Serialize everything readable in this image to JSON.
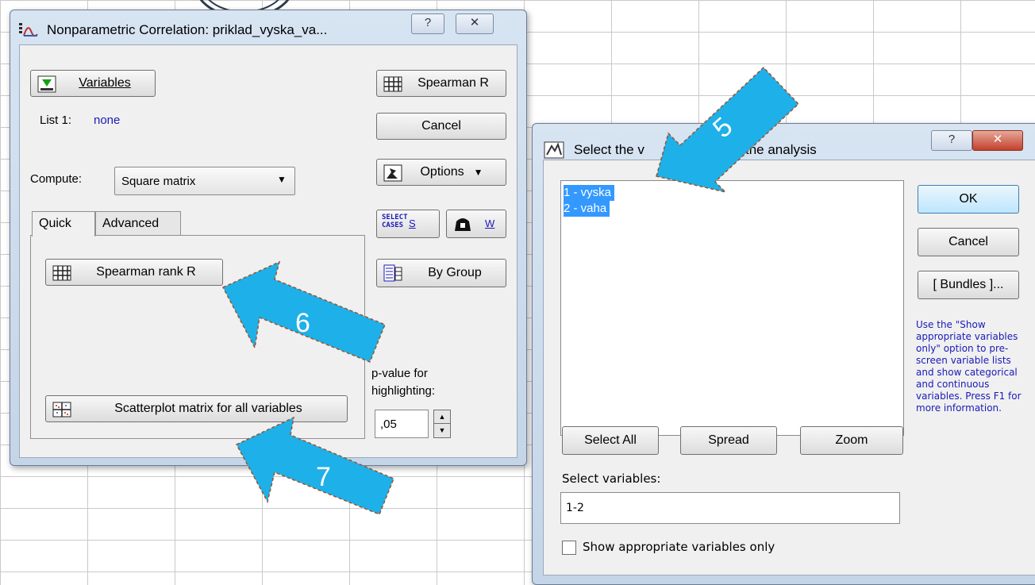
{
  "dialog1": {
    "title": "Nonparametric Correlation: priklad_vyska_va...",
    "help_glyph": "?",
    "close_glyph": "✕",
    "variables_button": "Variables",
    "list_label": "List 1:",
    "list_value": "none",
    "compute_label": "Compute:",
    "compute_value": "Square matrix",
    "tabs": [
      "Quick",
      "Advanced"
    ],
    "spearman_rank_button": "Spearman rank R",
    "scatterplot_button": "Scatterplot matrix for all variables",
    "spearman_button": "Spearman R",
    "cancel_button": "Cancel",
    "options_button": "Options",
    "select_cases_icon_text": "SELECT CASES",
    "s_button": "S",
    "w_button": "W",
    "by_group_button": "By Group",
    "pvalue_label_line1": "p-value for",
    "pvalue_label_line2": "highlighting:",
    "pvalue_value": ",05"
  },
  "dialog2": {
    "title_part1": "Select the v",
    "title_part2": "the analysis",
    "help_glyph": "?",
    "close_glyph": "✕",
    "list_items": [
      "1 - vyska",
      "2 - vaha"
    ],
    "ok_button": "OK",
    "cancel_button": "Cancel",
    "bundles_button": "[ Bundles ]...",
    "hint_text": "Use the \"Show appropriate variables only\" option to pre-screen variable lists and show categorical and continuous variables. Press F1 for more information.",
    "select_all_button": "Select All",
    "spread_button": "Spread",
    "zoom_button": "Zoom",
    "select_variables_label": "Select variables:",
    "select_variables_value": "1-2",
    "show_appropriate_label": "Show appropriate variables only",
    "show_appropriate_checked": false
  },
  "annotations": {
    "arrow5": "5",
    "arrow6": "6",
    "arrow7": "7",
    "arrow_color": "#1eb0e8"
  }
}
